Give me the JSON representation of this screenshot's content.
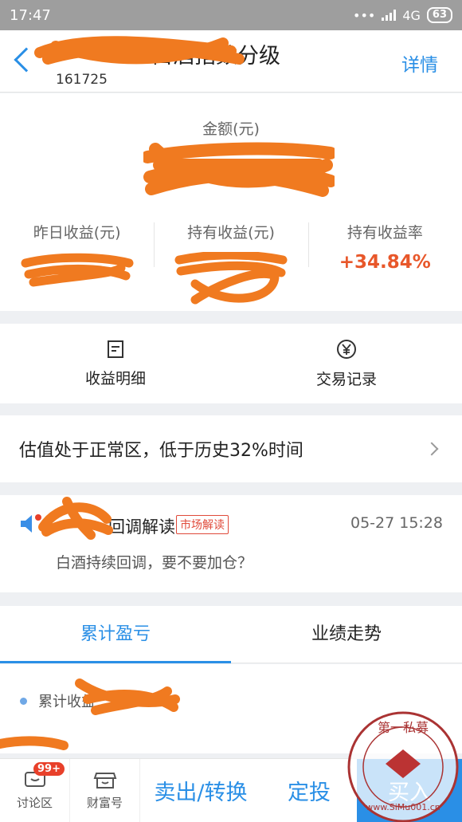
{
  "status_bar": {
    "time": "17:47",
    "network": "4G",
    "battery": "63"
  },
  "header": {
    "fund_name": "白酒指数分级",
    "fund_code": "161725",
    "detail_label": "详情"
  },
  "summary": {
    "amount_label": "金额(元)",
    "yesterday_label": "昨日收益(元)",
    "holding_label": "持有收益(元)",
    "rate_label": "持有收益率",
    "rate_value": "+34.84%"
  },
  "actions": [
    {
      "label": "收益明细",
      "icon": "document-icon"
    },
    {
      "label": "交易记录",
      "icon": "yen-circle-icon"
    }
  ],
  "valuation": {
    "text": "估值处于正常区，低于历史32%时间"
  },
  "news": {
    "title": "回调解读",
    "tag": "市场解读",
    "time": "05-27 15:28",
    "summary": "白酒持续回调，要不要加仓？"
  },
  "tabs": [
    {
      "label": "累计盈亏",
      "active": true
    },
    {
      "label": "业绩走势",
      "active": false
    }
  ],
  "cumulative": {
    "label": "累计收益"
  },
  "bottom_bar": {
    "discuss_label": "讨论区",
    "discuss_badge": "99+",
    "wealth_label": "财富号",
    "sell_label": "卖出/转换",
    "auto_invest_label": "定投",
    "buy_label": "买入"
  },
  "colors": {
    "accent": "#2a8fe6",
    "positive": "#e8572a",
    "redaction": "#f07a20"
  },
  "watermark": {
    "text": "第一私募",
    "url": "www.SiMu001.cn"
  }
}
